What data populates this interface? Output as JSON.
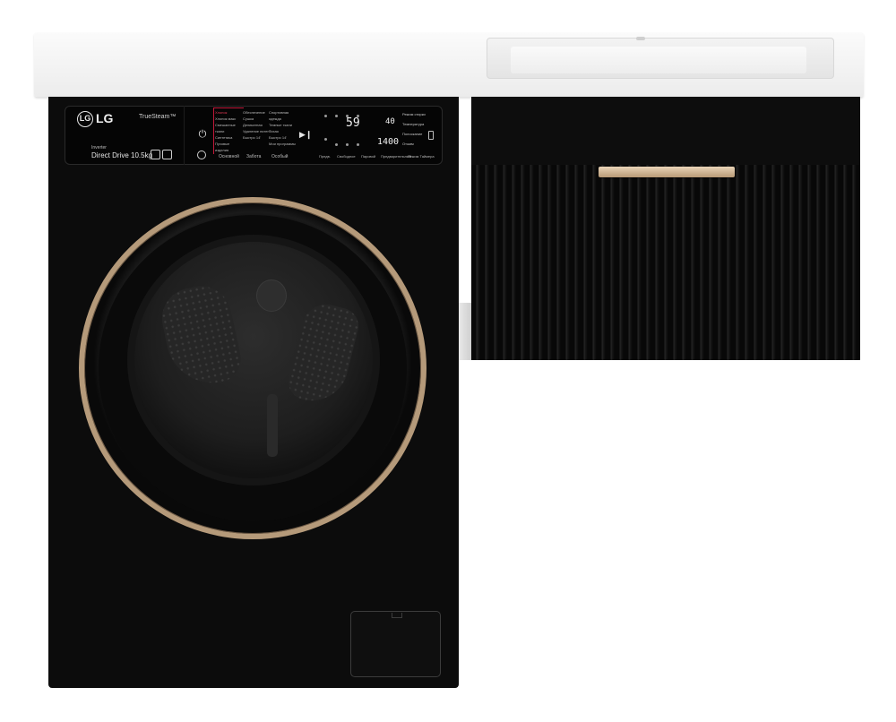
{
  "washer_panel": {
    "brand_mark": "LG",
    "brand": "LG",
    "truesteam": "TrueSteam™",
    "inverter": "Inverter",
    "direct_drive": "Direct Drive 10.5kg",
    "program_col1": [
      "Хлопок",
      "Хлопок макс",
      "Смешанные ткани",
      "Синтетика",
      "Пуховые изделия"
    ],
    "program_col2": [
      "Обеспечение",
      "Сушка",
      "Деликатная",
      "Удаление пятен",
      "Быстро 14'"
    ],
    "program_col3": [
      "Спортивная одежда",
      "Темные ткани",
      "Тихая",
      "Быстро 14'",
      "Мои программы"
    ],
    "category_1": "Основной",
    "category_2": "Забота",
    "category_3": "Особый",
    "display_time": "59",
    "display_temp": "40",
    "display_spin": "1400",
    "label_wash": "Режим стирки",
    "label_temp": "Температура",
    "label_rinse": "Полоскание",
    "label_spin": "Отжим",
    "bottom_1": "Предв.",
    "bottom_2": "Свободное",
    "bottom_3": "Паровой",
    "bottom_4": "Предварительный",
    "bottom_5": "Режим Таймера"
  },
  "colors": {
    "countertop": "#efefef",
    "washer_body": "#0c0c0c",
    "door_rim": "#b59a7a",
    "handle": "#d2b894",
    "cabinet": "#0d0d0d"
  }
}
